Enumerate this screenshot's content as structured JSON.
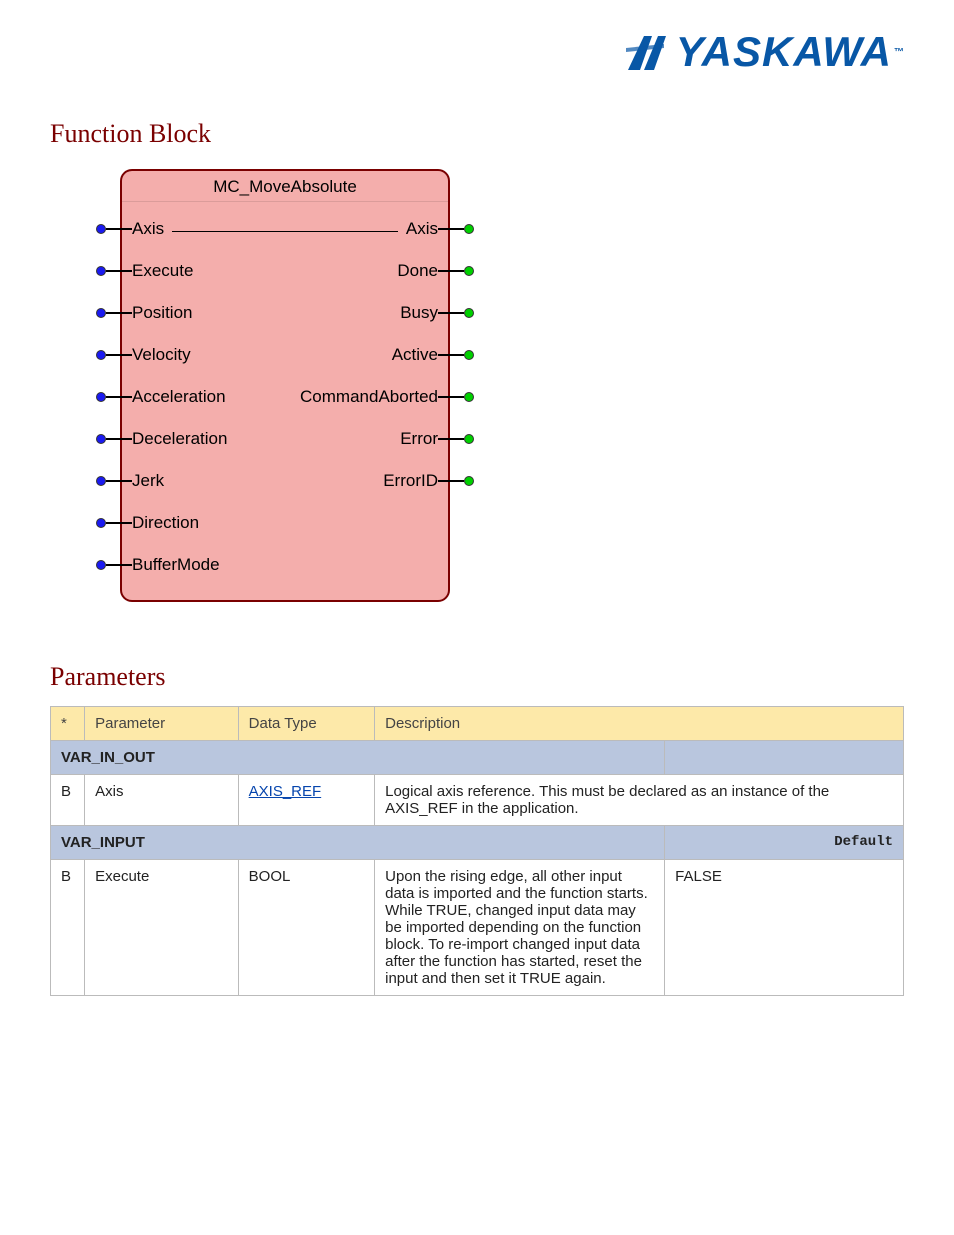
{
  "logo": {
    "text": "YASKAWA",
    "tm": "™"
  },
  "fb": {
    "heading": "Function Block",
    "title": "MC_MoveAbsolute",
    "inputs": [
      "Axis",
      "Execute",
      "Position",
      "Velocity",
      "Acceleration",
      "Deceleration",
      "Jerk",
      "Direction",
      "BufferMode"
    ],
    "outputs": [
      "Axis",
      "Done",
      "Busy",
      "Active",
      "CommandAborted",
      "Error",
      "ErrorID"
    ]
  },
  "params": {
    "heading": "Parameters",
    "hdr": {
      "n": "*",
      "pname": "Parameter",
      "dtype": "Data Type",
      "desc": "Description"
    },
    "sec1": {
      "left": "VAR_IN_OUT",
      "right": ""
    },
    "row1": {
      "n": "B",
      "pname": "Axis",
      "dtype_link": "AXIS_REF",
      "desc": "Logical axis reference. This must be declared as an instance of the AXIS_REF in the application."
    },
    "sec2": {
      "left": "VAR_INPUT",
      "right": "Default"
    },
    "row2": {
      "n": "B",
      "pname": "Execute",
      "dtype": "BOOL",
      "desc": "Upon the rising edge, all other input data is imported and the function starts. While TRUE, changed input data may be imported depending on the function block. To re-import changed input data after the function has started, reset the input and then set it TRUE again.",
      "def": "FALSE"
    }
  }
}
